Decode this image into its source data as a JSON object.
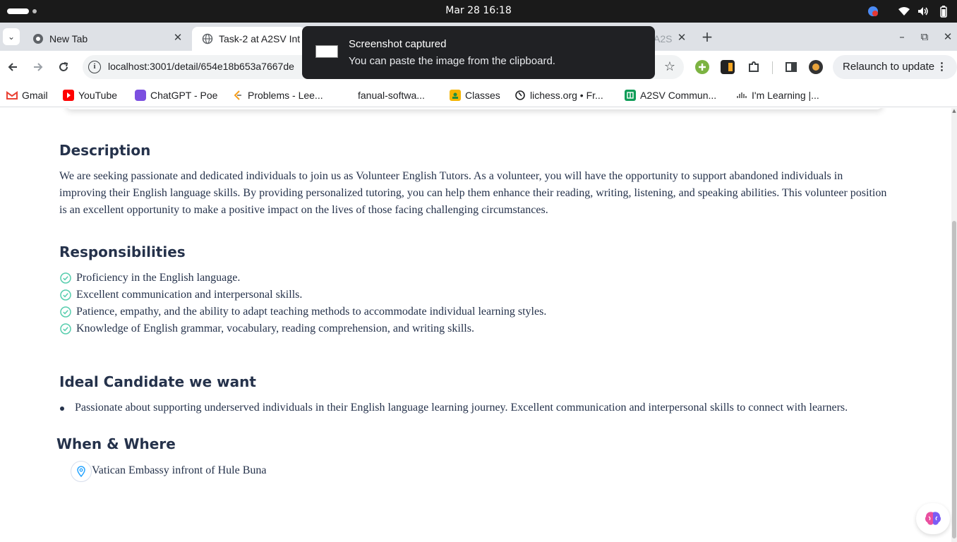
{
  "os_bar": {
    "clock": "Mar 28  16:18"
  },
  "tabs": [
    {
      "label": "New Tab",
      "icon": "chrome-icon"
    },
    {
      "label": "Task-2 at A2SV Int",
      "icon": "globe-icon"
    },
    {
      "label": "A2S",
      "icon": "globe-icon"
    }
  ],
  "toolbar": {
    "url": "localhost:3001/detail/654e18b653a7667de",
    "relaunch_label": "Relaunch to update"
  },
  "bookmarks": [
    {
      "label": "Gmail",
      "color": "#ea4335"
    },
    {
      "label": "YouTube",
      "color": "#ff0000"
    },
    {
      "label": "ChatGPT - Poe",
      "color": "#7b4fe0"
    },
    {
      "label": "Problems - Lee...",
      "color": "#f89f1b"
    },
    {
      "label": "fanual-softwa...",
      "color": "#ffffff"
    },
    {
      "label": "Classes",
      "color": "#f4b400"
    },
    {
      "label": "lichess.org • Fr...",
      "color": "#202124"
    },
    {
      "label": "A2SV Commun...",
      "color": "#0f9d58"
    },
    {
      "label": "I'm Learning |...",
      "color": "#555555"
    }
  ],
  "toast": {
    "title": "Screenshot captured",
    "message": "You can paste the image from the clipboard."
  },
  "page": {
    "description": {
      "heading": "Description",
      "lines": [
        "We are seeking passionate and dedicated individuals to join us as Volunteer English Tutors. As a volunteer, you will have the opportunity to support abandoned individuals in",
        "improving their English language skills. By providing personalized tutoring, you can help them enhance their reading, writing, listening, and speaking abilities. This volunteer position",
        "is an excellent opportunity to make a positive impact on the lives of those facing challenging circumstances."
      ]
    },
    "responsibilities": {
      "heading": "Responsibilities",
      "items": [
        "Proficiency in the English language.",
        "Excellent communication and interpersonal skills.",
        "Patience, empathy, and the ability to adapt teaching methods to accommodate individual learning styles.",
        "Knowledge of English grammar, vocabulary, reading comprehension, and writing skills."
      ]
    },
    "ideal_candidate": {
      "heading": "Ideal Candidate we want",
      "items": [
        "Passionate about supporting underserved individuals in their English language learning journey. Excellent communication and interpersonal skills to connect with learners."
      ]
    },
    "when_where": {
      "heading": "When & Where",
      "location": "Vatican Embassy infront of Hule Buna"
    }
  },
  "colors": {
    "heading": "#25324b",
    "check": "#56cdad",
    "location_pin": "#26a4ff"
  }
}
